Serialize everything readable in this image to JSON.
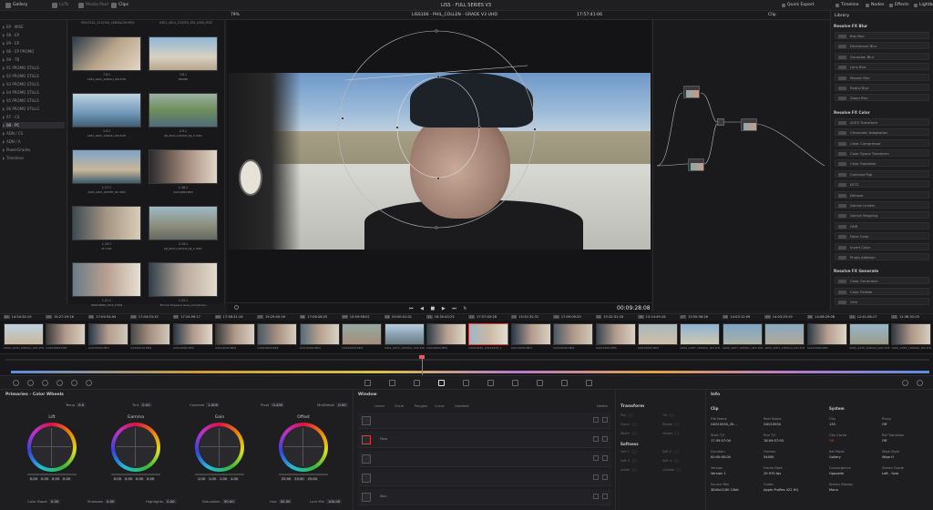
{
  "topbar": {
    "gallery": "Gallery",
    "luts": "LUTs",
    "media_pool": "Media Pool",
    "clips": "Clips",
    "title": "LISS - FULL SERIES V3",
    "quick_export": "Quick Export",
    "timeline": "Timeline",
    "nodes": "Nodes",
    "effects": "Effects",
    "lightbox": "Lightbox"
  },
  "viewer": {
    "zoom": "79%",
    "clip_title": "LISS106 - PHIL_COLLEN - GRADE V3 UHD",
    "timecode_top": "17:57:41:06",
    "mode": "Clip",
    "timecode": "00:09:28:08"
  },
  "gallery": {
    "header_left": "MOV1322_2314194_LKWOA.DH.MOV",
    "header_right": "A301_0614_1202EG_001_0000_R3D",
    "stills": [
      {
        "label": "7.8.1",
        "name": "A001_A002_1000GU_001.R3D"
      },
      {
        "label": "3.8.1",
        "name": "DRONE"
      },
      {
        "label": "1.9.1",
        "name": "A001_A002_1002GU_001.R3D"
      },
      {
        "label": "2.9.1",
        "name": "DJI_0023_1023CD_DJI_0 .MOV"
      },
      {
        "label": "1.17.1",
        "name": "A004_A007_1003TE_001.R3D"
      },
      {
        "label": "1.18.1",
        "name": "GX010000.MP4"
      },
      {
        "label": "1.19.1",
        "name": "PC CAM"
      },
      {
        "label": "2.19.1",
        "name": "DJI_0023_1023CD_DJI_0 .MOV"
      },
      {
        "label": "1.21.1",
        "name": "3X0010086_2019_1.MP4"
      },
      {
        "label": "1.22.1",
        "name": "Phil Car Exposure Issue_Comparison"
      }
    ]
  },
  "albums": [
    "EP - MISE",
    "08 - EP",
    "09 - EP",
    "06 - EP PROMO",
    "09 - TB",
    "01 PROMO STILLS",
    "02 PROMO STILLS",
    "03 PROMO STILLS",
    "04 PROMO STILLS",
    "05 PROMO STILLS",
    "06 PROMO STILLS",
    "07 - CS",
    "08 - PC",
    "ADN / CS",
    "ADN / A",
    "PowerGrades",
    "Timelines"
  ],
  "library": {
    "header": "Library",
    "sections": [
      {
        "title": "Resolve FX Blur",
        "items": [
          "Box Blur",
          "Directional Blur",
          "Gaussian Blur",
          "Lens Blur",
          "Mosaic Blur",
          "Radial Blur",
          "Zoom Blur"
        ]
      },
      {
        "title": "Resolve FX Color",
        "items": [
          "ACES Transform",
          "Chromatic Adaptation",
          "Color Compressor",
          "Color Space Transform",
          "Color Stabilizer",
          "Contrast Pop",
          "DCTL",
          "Dehaze",
          "Gamut Limiter",
          "Gamut Mapping",
          "HDR",
          "False Color",
          "Invert Color",
          "Photo Addition"
        ]
      },
      {
        "title": "Resolve FX Generate",
        "items": [
          "Color Generator",
          "Color Palette",
          "Grid"
        ]
      }
    ]
  },
  "clips": [
    {
      "n": "01",
      "tc": "14:54:34:19",
      "name": "A002_A015_1000GU_001.R3D"
    },
    {
      "n": "02",
      "tc": "15:27:29:16",
      "name": "GX010008.MP4"
    },
    {
      "n": "03",
      "tc": "17:04:54:04",
      "name": "GX010009.MP4"
    },
    {
      "n": "04",
      "tc": "17:04:53:15",
      "name": "GX010010.MP4"
    },
    {
      "n": "05",
      "tc": "17:24:59:17",
      "name": "GX010009.MP4"
    },
    {
      "n": "06",
      "tc": "17:58:31:16",
      "name": "GX010009.MP4"
    },
    {
      "n": "07",
      "tc": "15:29:40:16",
      "name": "GX010009.MP4"
    },
    {
      "n": "08",
      "tc": "17:06:28:25",
      "name": "GX010009.MP4"
    },
    {
      "n": "09",
      "tc": "15:59:58:02",
      "name": "GX010009.MP4"
    },
    {
      "n": "10",
      "tc": "00:00:01:01",
      "name": "A002_A015_1000GU_001.R3D"
    },
    {
      "n": "11",
      "tc": "16:30:43:23",
      "name": "GX010009.MP4"
    },
    {
      "n": "12",
      "tc": "17:57:40:28",
      "name": "GX010020_20210928_1"
    },
    {
      "n": "13",
      "tc": "15:32:32:31",
      "name": "GX010009.MP4"
    },
    {
      "n": "14",
      "tc": "17:09:09:29",
      "name": "GX010008.MP4"
    },
    {
      "n": "15",
      "tc": "15:32:31:16",
      "name": "GX010009.MP4"
    },
    {
      "n": "16",
      "tc": "15:14:49:18",
      "name": "GX010009.MP4"
    },
    {
      "n": "17",
      "tc": "13:55:36:26",
      "name": "A002_A015_1000GU_001.R3D"
    },
    {
      "n": "18",
      "tc": "14:03:12:09",
      "name": "A004_A007_1000GU_001.R3D"
    },
    {
      "n": "19",
      "tc": "14:03:29:19",
      "name": "A004_A007_1000GU_001.R3D"
    },
    {
      "n": "20",
      "tc": "14:08:29:08",
      "name": "GX010009.MP4"
    },
    {
      "n": "21",
      "tc": "12:41:08:17",
      "name": "A002_A015_1000GU_001.R3D"
    },
    {
      "n": "22",
      "tc": "11:36:32:05",
      "name": "A002_A015_1000GU_001.R3D"
    }
  ],
  "primaries": {
    "title": "Primaries - Color Wheels",
    "temp_label": "Temp",
    "temp": "0.0",
    "tint_label": "Tint",
    "tint": "0.00",
    "contrast_label": "Contrast",
    "contrast": "1.000",
    "pivot_label": "Pivot",
    "pivot": "0.435",
    "middetail_label": "Mid/Detail",
    "middetail": "0.00",
    "wheels": [
      {
        "name": "Lift",
        "vals": [
          "0.00",
          "0.00",
          "0.00",
          "0.00"
        ]
      },
      {
        "name": "Gamma",
        "vals": [
          "0.00",
          "0.00",
          "0.00",
          "0.00"
        ]
      },
      {
        "name": "Gain",
        "vals": [
          "1.00",
          "1.00",
          "1.00",
          "1.00"
        ]
      },
      {
        "name": "Offset",
        "vals": [
          "25.00",
          "25.00",
          "25.00"
        ]
      }
    ],
    "colorboost_label": "Color Boost",
    "colorboost": "0.00",
    "shadows_label": "Shadows",
    "shadows": "0.00",
    "highlights_label": "Highlights",
    "highlights": "0.00",
    "saturation_label": "Saturation",
    "saturation": "50.00",
    "hue_label": "Hue",
    "hue": "50.00",
    "lummix_label": "Lum Mix",
    "lummix": "100.00"
  },
  "window_panel": {
    "title": "Window",
    "tools": [
      "Linear",
      "Circle",
      "Polygon",
      "Curve",
      "Gradient"
    ],
    "delete": "Delete",
    "rows": [
      "",
      "Face",
      "",
      "",
      "Skin"
    ]
  },
  "transform": {
    "title": "Transform",
    "fields": [
      "Pan",
      "Tilt",
      "Zoom",
      "Rotate",
      "Width",
      "Height"
    ],
    "softness": "Softness",
    "soft_fields": [
      "Soft 1",
      "Soft 2",
      "Soft 3",
      "Soft 4",
      "Inside",
      "Outside"
    ]
  },
  "info": {
    "title": "Info",
    "clip_header": "Clip",
    "system_header": "System",
    "left": [
      {
        "k": "File Name",
        "v": "GX010034_20..."
      },
      {
        "k": "Start T/C",
        "v": "17:39:57:00"
      },
      {
        "k": "Duration",
        "v": "00:00:00:00"
      },
      {
        "k": "Version",
        "v": "Version 1"
      },
      {
        "k": "Source Res",
        "v": "3840x2160 10bit"
      }
    ],
    "mid": [
      {
        "k": "Reel Name",
        "v": "GX010034"
      },
      {
        "k": "End T/C",
        "v": "18:09:57:00"
      },
      {
        "k": "Frames",
        "v": "54000"
      },
      {
        "k": "Frame Rate",
        "v": "29.970 fps"
      },
      {
        "k": "Codec",
        "v": "Apple ProRes 422 HQ"
      }
    ],
    "right1": [
      {
        "k": "Clip",
        "v": "135"
      },
      {
        "k": "Clip Cache",
        "v": "Off"
      },
      {
        "k": "Ref Mode",
        "v": "Gallery"
      },
      {
        "k": "Convergence",
        "v": "Opposite"
      },
      {
        "k": "Stereo Display",
        "v": "Mono"
      }
    ],
    "right2": [
      {
        "k": "Proxy",
        "v": "Off"
      },
      {
        "k": "Ref Transition",
        "v": "Off"
      },
      {
        "k": "Wipe Style",
        "v": "Wipe H"
      },
      {
        "k": "Stereo Grade",
        "v": "Left - Solo"
      }
    ]
  },
  "colors": {
    "accent": "#e23b3b",
    "playhead": "#e85a5a",
    "highlight": "#c8c8cc"
  }
}
